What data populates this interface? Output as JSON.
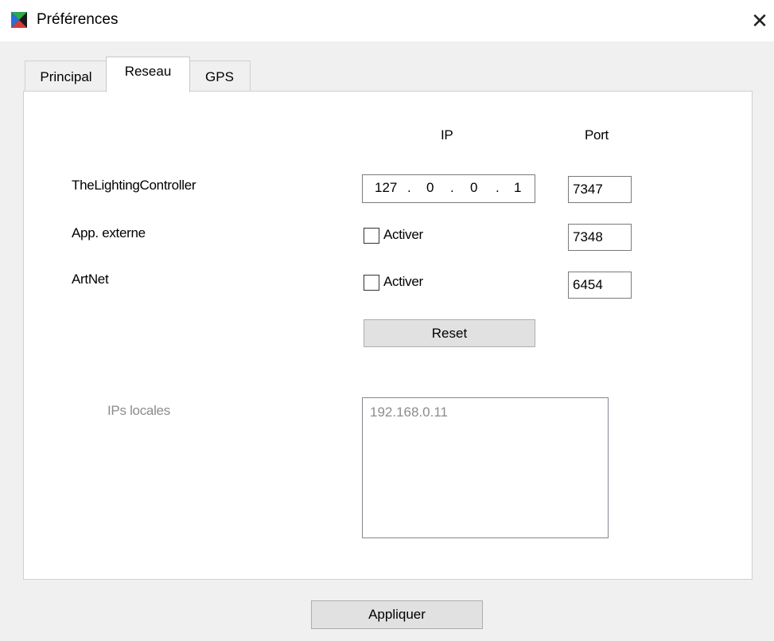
{
  "window": {
    "title": "Préférences",
    "app_icon": "flag-icon",
    "close_glyph": "✕"
  },
  "tabs": [
    {
      "label": "Principal",
      "active": false
    },
    {
      "label": "Reseau",
      "active": true
    },
    {
      "label": "GPS",
      "active": false
    }
  ],
  "headers": {
    "ip": "IP",
    "port": "Port"
  },
  "rows": [
    {
      "label": "TheLightingController",
      "ip": [
        "127",
        "0",
        "0",
        "1"
      ],
      "port": "7347"
    },
    {
      "label": "App. externe",
      "checkbox_label": "Activer",
      "checked": false,
      "port": "7348"
    },
    {
      "label": "ArtNet",
      "checkbox_label": "Activer",
      "checked": false,
      "port": "6454"
    }
  ],
  "ip_separator": ".",
  "reset_label": "Reset",
  "local_ips": {
    "label": "IPs locales",
    "items": [
      "192.168.0.11"
    ]
  },
  "apply_label": "Appliquer",
  "colors": {
    "window_bg": "#f0f0f0",
    "titlebar_bg": "#ffffff",
    "disabled_text": "#8c8c8c",
    "button_bg": "#e1e1e1"
  }
}
